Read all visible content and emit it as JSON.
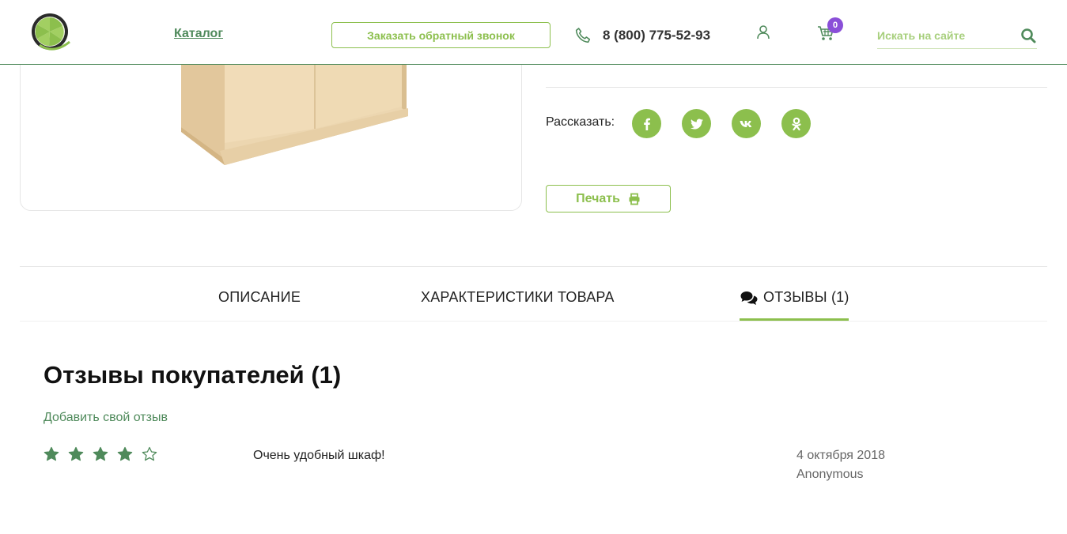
{
  "header": {
    "catalog_label": "Каталог",
    "callback_label": "Заказать обратный звонок",
    "phone": "8 (800) 775-52-93",
    "cart_count": "0",
    "search_placeholder": "Искать на сайте"
  },
  "share": {
    "label": "Рассказать:",
    "networks": [
      "facebook-icon",
      "twitter-icon",
      "vk-icon",
      "odnoklassniki-icon"
    ]
  },
  "print": {
    "label": "Печать"
  },
  "tabs": {
    "description": "ОПИСАНИЕ",
    "specs": "ХАРАКТЕРИСТИКИ ТОВАРА",
    "reviews": "ОТЗЫВЫ (1)",
    "active": "reviews"
  },
  "reviews": {
    "title": "Отзывы покупателей (1)",
    "add_label": "Добавить свой отзыв",
    "items": [
      {
        "rating": 4,
        "rating_max": 5,
        "text": "Очень удобный шкаф!",
        "date": "4 октября 2018",
        "author": "Anonymous"
      }
    ]
  },
  "colors": {
    "accent_green": "#8cbf4d",
    "dark_green": "#4f8a5b",
    "badge_purple": "#8a4fd8"
  }
}
